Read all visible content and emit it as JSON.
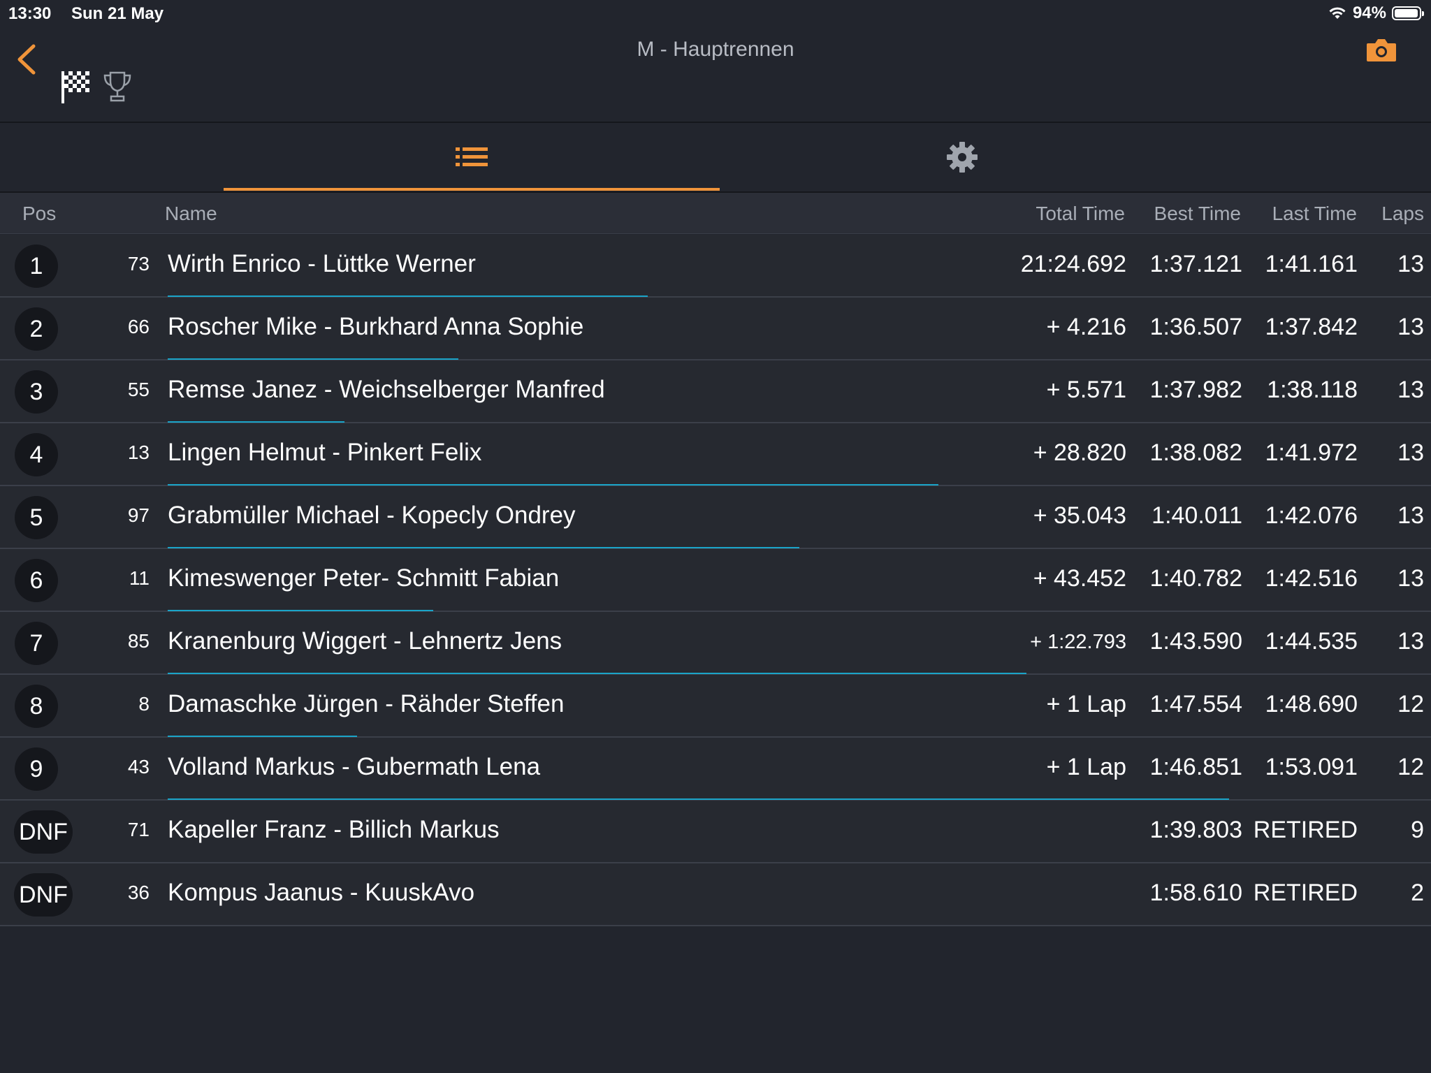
{
  "status_bar": {
    "time": "13:30",
    "date": "Sun 21 May",
    "battery": "94%"
  },
  "header": {
    "title": "M - Hauptrennen"
  },
  "table": {
    "columns": {
      "pos": "Pos",
      "name": "Name",
      "total_time": "Total Time",
      "best_time": "Best Time",
      "last_time": "Last Time",
      "laps": "Laps"
    },
    "rows": [
      {
        "pos": "1",
        "number": "73",
        "name": "Wirth  Enrico - Lüttke Werner",
        "total": "21:24.692",
        "best": "1:37.121",
        "last": "1:41.161",
        "laps": "13",
        "progress_pct": 38
      },
      {
        "pos": "2",
        "number": "66",
        "name": "Roscher Mike - Burkhard Anna Sophie",
        "total": "+ 4.216",
        "best": "1:36.507",
        "last": "1:37.842",
        "laps": "13",
        "progress_pct": 23
      },
      {
        "pos": "3",
        "number": "55",
        "name": "Remse  Janez - Weichselberger Manfred",
        "total": "+ 5.571",
        "best": "1:37.982",
        "last": "1:38.118",
        "laps": "13",
        "progress_pct": 14
      },
      {
        "pos": "4",
        "number": "13",
        "name": "Lingen  Helmut - Pinkert Felix",
        "total": "+ 28.820",
        "best": "1:38.082",
        "last": "1:41.972",
        "laps": "13",
        "progress_pct": 61
      },
      {
        "pos": "5",
        "number": "97",
        "name": "Grabmüller  Michael - Kopecly Ondrey",
        "total": "+ 35.043",
        "best": "1:40.011",
        "last": "1:42.076",
        "laps": "13",
        "progress_pct": 50
      },
      {
        "pos": "6",
        "number": "11",
        "name": "Kimeswenger Peter- Schmitt Fabian",
        "total": "+ 43.452",
        "best": "1:40.782",
        "last": "1:42.516",
        "laps": "13",
        "progress_pct": 21
      },
      {
        "pos": "7",
        "number": "85",
        "name": "Kranenburg Wiggert - Lehnertz Jens",
        "total": "+ 1:22.793",
        "best": "1:43.590",
        "last": "1:44.535",
        "laps": "13",
        "progress_pct": 68
      },
      {
        "pos": "8",
        "number": "8",
        "name": "Damaschke  Jürgen - Rähder Steffen",
        "total": "+ 1 Lap",
        "best": "1:47.554",
        "last": "1:48.690",
        "laps": "12",
        "progress_pct": 15
      },
      {
        "pos": "9",
        "number": "43",
        "name": "Volland Markus - Gubermath Lena",
        "total": "+ 1 Lap",
        "best": "1:46.851",
        "last": "1:53.091",
        "laps": "12",
        "progress_pct": 84
      },
      {
        "pos": "DNF",
        "number": "71",
        "name": "Kapeller  Franz - Billich Markus",
        "total": "",
        "best": "1:39.803",
        "last": "RETIRED",
        "laps": "9",
        "progress_pct": 0
      },
      {
        "pos": "DNF",
        "number": "36",
        "name": "Kompus Jaanus - KuuskAvo",
        "total": "",
        "best": "1:58.610",
        "last": "RETIRED",
        "laps": "2",
        "progress_pct": 0
      }
    ]
  },
  "icons": {
    "back": "chevron-left-icon",
    "camera": "camera-icon",
    "flag": "checkered-flag-icon",
    "trophy": "trophy-icon",
    "list_tab": "list-icon",
    "settings_tab": "gear-icon"
  },
  "colors": {
    "accent": "#f0943a",
    "progress": "#1aa4c8",
    "background": "#22252d"
  }
}
